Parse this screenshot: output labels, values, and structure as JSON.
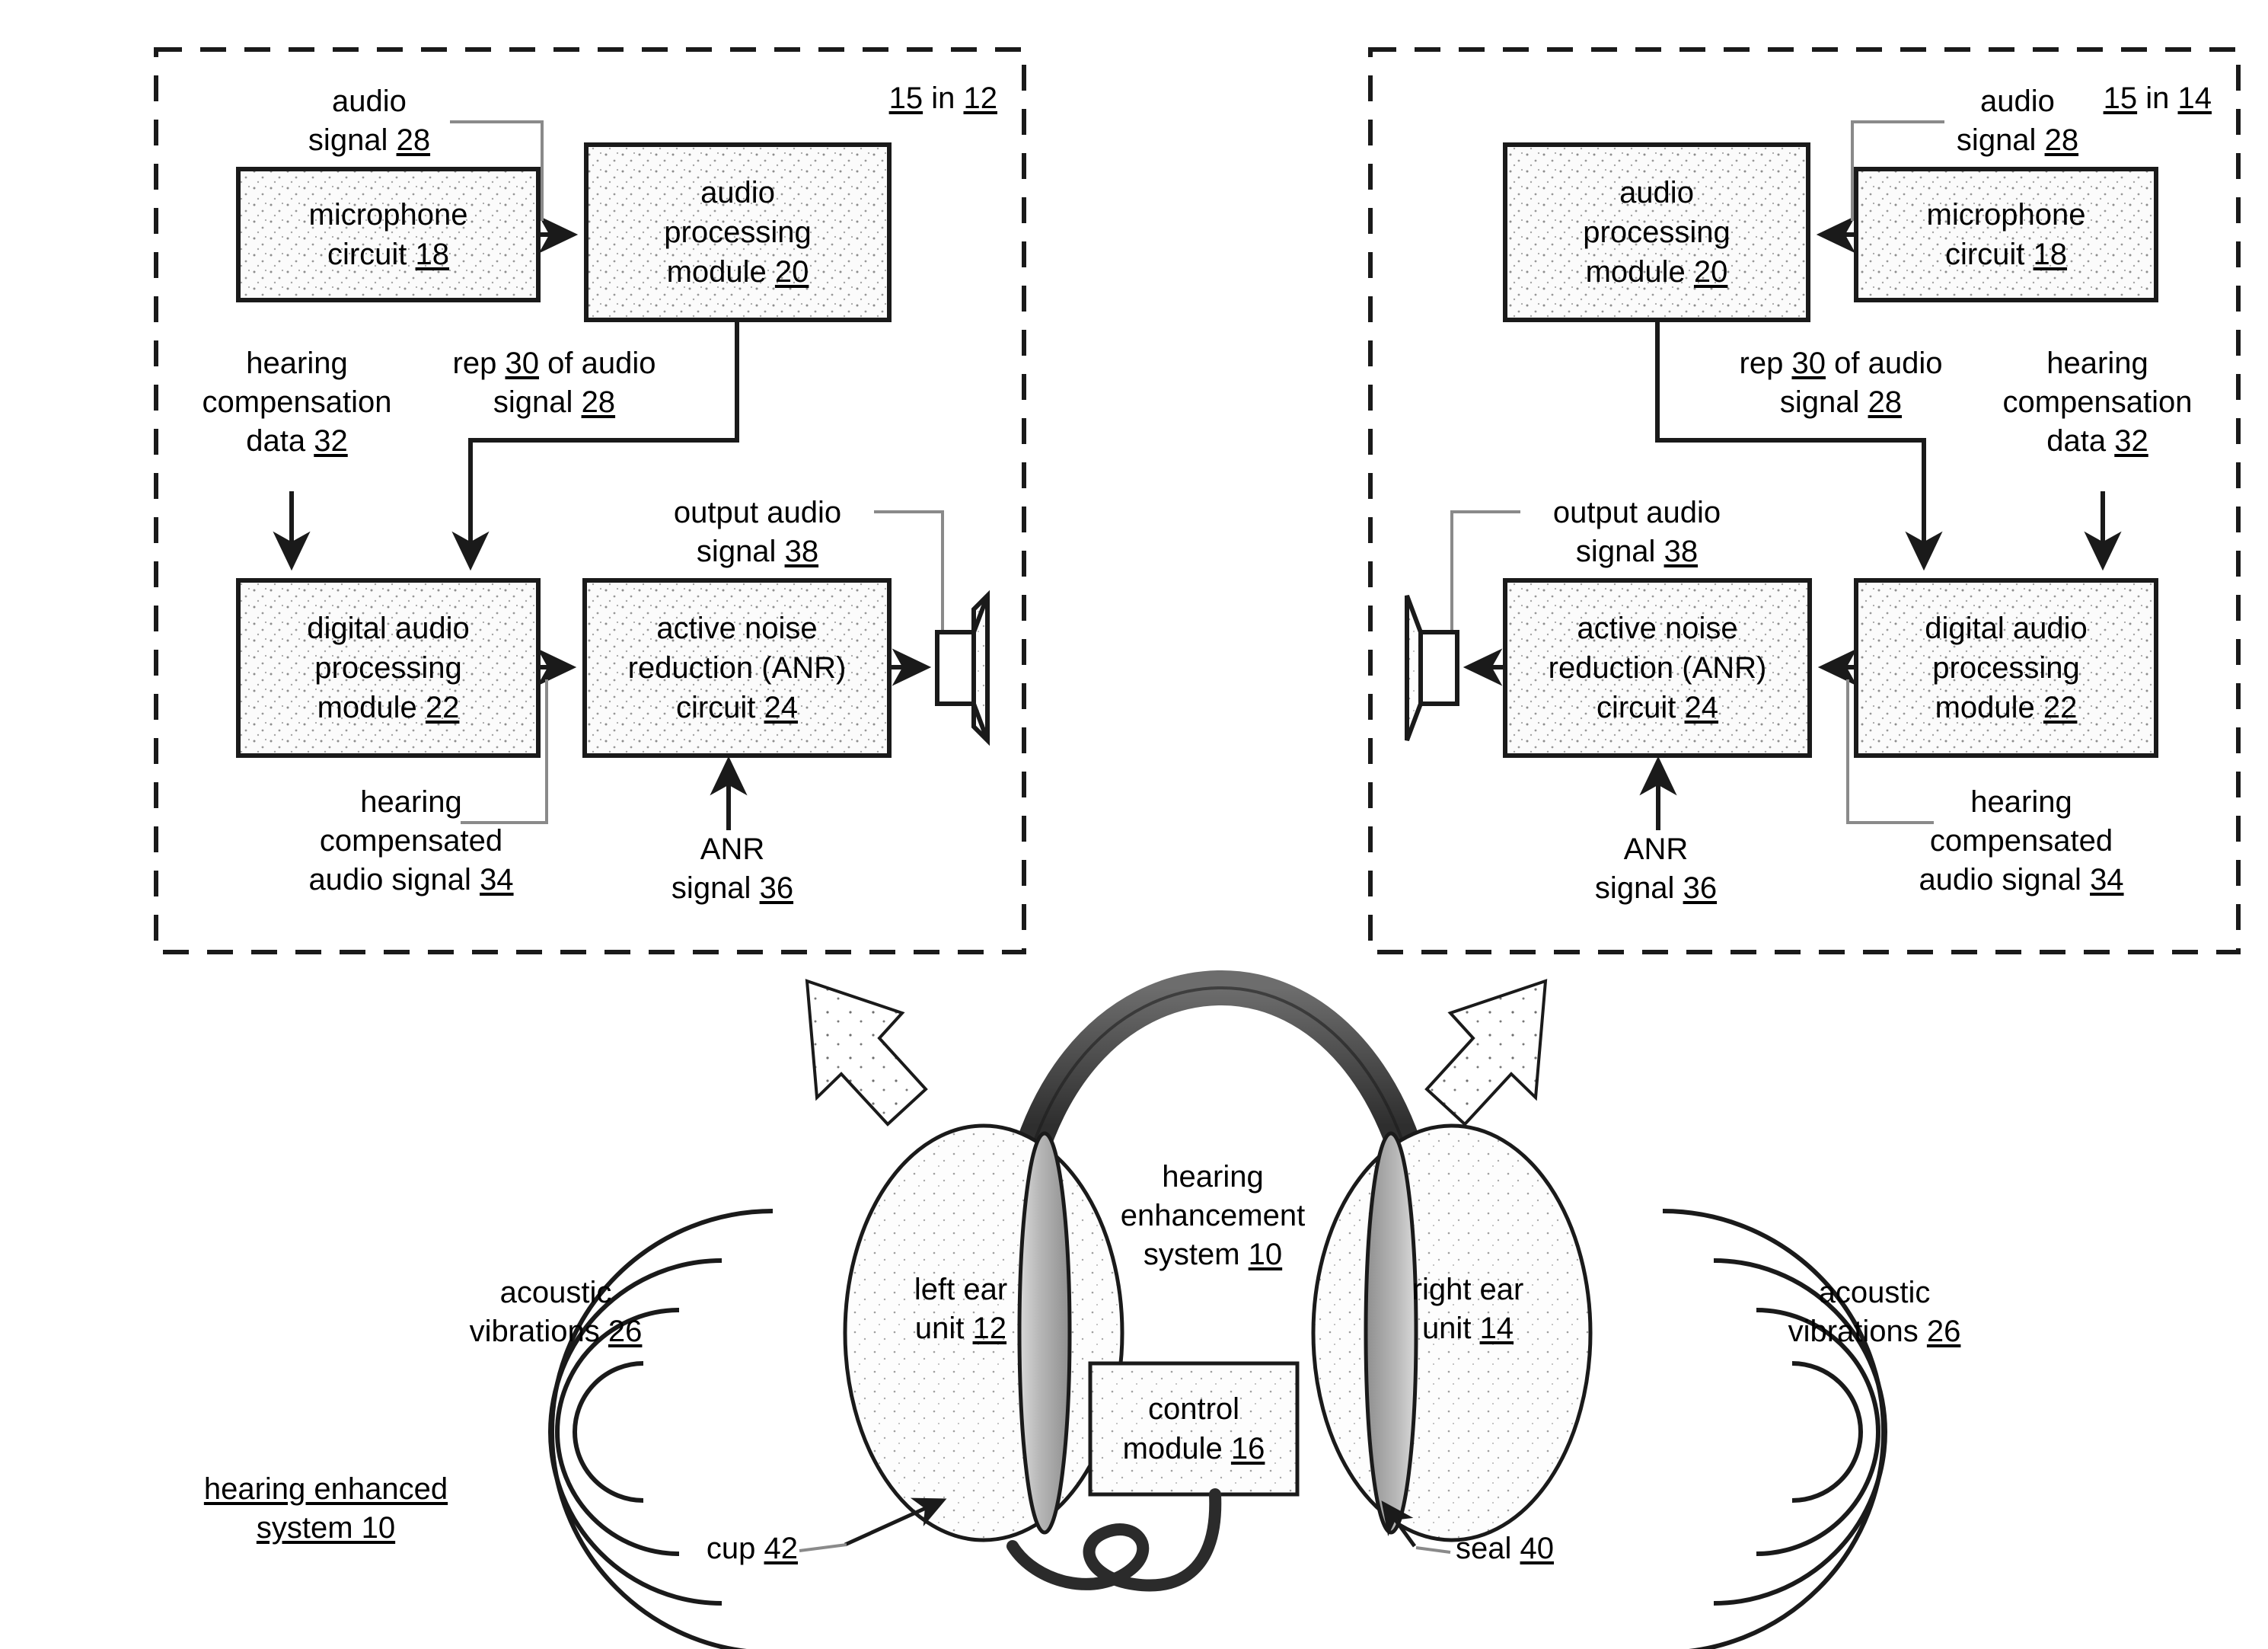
{
  "figure": {
    "title": "hearing enhanced system 10",
    "title_line1": "hearing enhanced",
    "title_line2": "system 10"
  },
  "panels": [
    {
      "id": "left-panel",
      "tag_prefix": "15",
      "tag_middle": "in",
      "tag_suffix": "12",
      "tag_full": "15 in 12",
      "boxes": [
        {
          "id": "microphone-circuit",
          "line1": "microphone",
          "line2": "circuit",
          "ref": "18"
        },
        {
          "id": "audio-processing-module",
          "line1": "audio",
          "line2": "processing",
          "line3": "module",
          "ref": "20"
        },
        {
          "id": "digital-audio-processing-module",
          "line1": "digital audio",
          "line2": "processing",
          "line3": "module",
          "ref": "22"
        },
        {
          "id": "anr-circuit",
          "line1": "active noise",
          "line2": "reduction (ANR)",
          "line3": "circuit",
          "ref": "24"
        }
      ],
      "labels": [
        {
          "id": "audio-signal-28",
          "line1": "audio",
          "line2": "signal",
          "ref": "28"
        },
        {
          "id": "hearing-compensation-data-32",
          "line1": "hearing",
          "line2": "compensation",
          "line3": "data",
          "ref": "32"
        },
        {
          "id": "rep-30-of-audio-signal-28",
          "line1a": "rep",
          "line1ref": "30",
          "line1b": "of audio",
          "line2": "signal",
          "ref": "28"
        },
        {
          "id": "output-audio-signal-38",
          "line1": "output audio",
          "line2": "signal",
          "ref": "38"
        },
        {
          "id": "hearing-compensated-audio-signal-34",
          "line1": "hearing",
          "line2": "compensated",
          "line3": "audio signal",
          "ref": "34"
        },
        {
          "id": "anr-signal-36",
          "line1": "ANR",
          "line2": "signal",
          "ref": "36"
        }
      ]
    },
    {
      "id": "right-panel",
      "tag_prefix": "15",
      "tag_middle": "in",
      "tag_suffix": "14",
      "tag_full": "15 in 14",
      "boxes": [
        {
          "id": "microphone-circuit",
          "line1": "microphone",
          "line2": "circuit",
          "ref": "18"
        },
        {
          "id": "audio-processing-module",
          "line1": "audio",
          "line2": "processing",
          "line3": "module",
          "ref": "20"
        },
        {
          "id": "digital-audio-processing-module",
          "line1": "digital audio",
          "line2": "processing",
          "line3": "module",
          "ref": "22"
        },
        {
          "id": "anr-circuit",
          "line1": "active noise",
          "line2": "reduction (ANR)",
          "line3": "circuit",
          "ref": "24"
        }
      ],
      "labels": [
        {
          "id": "audio-signal-28",
          "line1": "audio",
          "line2": "signal",
          "ref": "28"
        },
        {
          "id": "hearing-compensation-data-32",
          "line1": "hearing",
          "line2": "compensation",
          "line3": "data",
          "ref": "32"
        },
        {
          "id": "rep-30-of-audio-signal-28",
          "line1a": "rep",
          "line1ref": "30",
          "line1b": "of audio",
          "line2": "signal",
          "ref": "28"
        },
        {
          "id": "output-audio-signal-38",
          "line1": "output audio",
          "line2": "signal",
          "ref": "38"
        },
        {
          "id": "hearing-compensated-audio-signal-34",
          "line1": "hearing",
          "line2": "compensated",
          "line3": "audio signal",
          "ref": "34"
        },
        {
          "id": "anr-signal-36",
          "line1": "ANR",
          "line2": "signal",
          "ref": "36"
        }
      ]
    }
  ],
  "headset": {
    "system_label_line1": "hearing",
    "system_label_line2": "enhancement",
    "system_label_line3": "system",
    "system_ref": "10",
    "left_cup_line1": "left ear",
    "left_cup_line2": "unit",
    "left_cup_ref": "12",
    "right_cup_line1": "right ear",
    "right_cup_line2": "unit",
    "right_cup_ref": "14",
    "control_module_line1": "control",
    "control_module_line2": "module",
    "control_module_ref": "16",
    "cup_label": "cup",
    "cup_ref": "42",
    "seal_label": "seal",
    "seal_ref": "40"
  },
  "acoustic": {
    "left_line1": "acoustic",
    "left_line2": "vibrations",
    "left_ref": "26",
    "right_line1": "acoustic",
    "right_line2": "vibrations",
    "right_ref": "26"
  },
  "colors": {
    "line": "#1a1a1a",
    "box_fill": "#f2f2f2",
    "cup_fill": "#ececec",
    "seal_fill": "#c9c9c9",
    "band_fill": "#3a3a3a",
    "background": "#ffffff"
  }
}
